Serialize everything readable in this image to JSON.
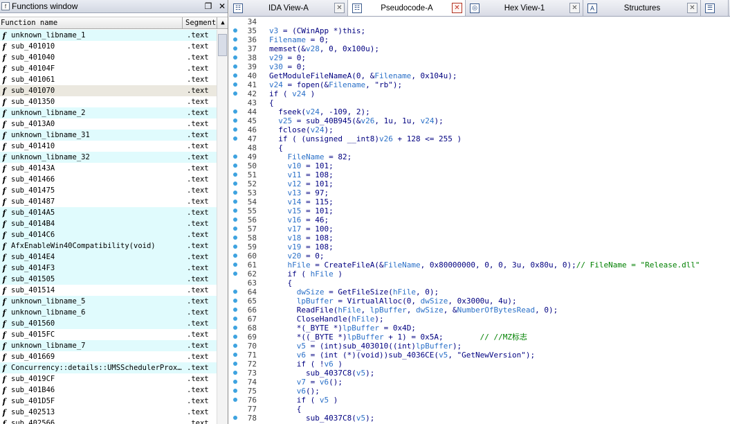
{
  "functions_window": {
    "title": "Functions window",
    "col_name": "Function name",
    "col_segment": "Segment",
    "rows": [
      {
        "name": "unknown_libname_1",
        "segment": ".text",
        "style": "lib"
      },
      {
        "name": "sub_401010",
        "segment": ".text",
        "style": ""
      },
      {
        "name": "sub_401040",
        "segment": ".text",
        "style": ""
      },
      {
        "name": "sub_40104F",
        "segment": ".text",
        "style": ""
      },
      {
        "name": "sub_401061",
        "segment": ".text",
        "style": ""
      },
      {
        "name": "sub_401070",
        "segment": ".text",
        "style": "sel"
      },
      {
        "name": "sub_401350",
        "segment": ".text",
        "style": ""
      },
      {
        "name": "unknown_libname_2",
        "segment": ".text",
        "style": "lib"
      },
      {
        "name": "sub_4013A0",
        "segment": ".text",
        "style": ""
      },
      {
        "name": "unknown_libname_31",
        "segment": ".text",
        "style": "lib"
      },
      {
        "name": "sub_401410",
        "segment": ".text",
        "style": ""
      },
      {
        "name": "unknown_libname_32",
        "segment": ".text",
        "style": "lib"
      },
      {
        "name": "sub_40143A",
        "segment": ".text",
        "style": ""
      },
      {
        "name": "sub_401466",
        "segment": ".text",
        "style": ""
      },
      {
        "name": "sub_401475",
        "segment": ".text",
        "style": ""
      },
      {
        "name": "sub_401487",
        "segment": ".text",
        "style": ""
      },
      {
        "name": "sub_4014A5",
        "segment": ".text",
        "style": "lib"
      },
      {
        "name": "sub_4014B4",
        "segment": ".text",
        "style": "lib"
      },
      {
        "name": "sub_4014C6",
        "segment": ".text",
        "style": "lib"
      },
      {
        "name": "AfxEnableWin40Compatibility(void)",
        "segment": ".text",
        "style": "lib"
      },
      {
        "name": "sub_4014E4",
        "segment": ".text",
        "style": "lib"
      },
      {
        "name": "sub_4014F3",
        "segment": ".text",
        "style": "lib"
      },
      {
        "name": "sub_401505",
        "segment": ".text",
        "style": "lib"
      },
      {
        "name": "sub_401514",
        "segment": ".text",
        "style": ""
      },
      {
        "name": "unknown_libname_5",
        "segment": ".text",
        "style": "lib"
      },
      {
        "name": "unknown_libname_6",
        "segment": ".text",
        "style": "lib"
      },
      {
        "name": "sub_401560",
        "segment": ".text",
        "style": "lib"
      },
      {
        "name": "sub_4015FC",
        "segment": ".text",
        "style": ""
      },
      {
        "name": "unknown_libname_7",
        "segment": ".text",
        "style": "lib"
      },
      {
        "name": "sub_401669",
        "segment": ".text",
        "style": ""
      },
      {
        "name": "Concurrency::details::UMSSchedulerProx…",
        "segment": ".text",
        "style": "lib"
      },
      {
        "name": "sub_4019CF",
        "segment": ".text",
        "style": ""
      },
      {
        "name": "sub_401B46",
        "segment": ".text",
        "style": ""
      },
      {
        "name": "sub_401D5F",
        "segment": ".text",
        "style": ""
      },
      {
        "name": "sub_402513",
        "segment": ".text",
        "style": ""
      },
      {
        "name": "sub_402566",
        "segment": ".text",
        "style": ""
      }
    ]
  },
  "tabs": [
    {
      "label": "IDA View-A",
      "icon": "ida-view-icon",
      "glyph": "☷",
      "active": false
    },
    {
      "label": "Pseudocode-A",
      "icon": "pseudocode-icon",
      "glyph": "☷",
      "active": true
    },
    {
      "label": "Hex View-1",
      "icon": "hex-view-icon",
      "glyph": "◎",
      "active": false
    },
    {
      "label": "Structures",
      "icon": "structures-icon",
      "glyph": "A",
      "active": false
    },
    {
      "label": "",
      "icon": "extra-tab-icon",
      "glyph": "☰",
      "active": false
    }
  ],
  "code_lines": [
    {
      "n": "34",
      "dot": false,
      "t": ""
    },
    {
      "n": "35",
      "dot": true,
      "t": "v3 = (CWinApp *)this;"
    },
    {
      "n": "36",
      "dot": true,
      "t": "Filename = 0;"
    },
    {
      "n": "37",
      "dot": true,
      "t": "memset(&v28, 0, 0x100u);"
    },
    {
      "n": "38",
      "dot": true,
      "t": "v29 = 0;"
    },
    {
      "n": "39",
      "dot": true,
      "t": "v30 = 0;"
    },
    {
      "n": "40",
      "dot": true,
      "t": "GetModuleFileNameA(0, &Filename, 0x104u);"
    },
    {
      "n": "41",
      "dot": true,
      "t": "v24 = fopen(&Filename, \"rb\");"
    },
    {
      "n": "42",
      "dot": true,
      "t": "if ( v24 )"
    },
    {
      "n": "43",
      "dot": false,
      "t": "{"
    },
    {
      "n": "44",
      "dot": true,
      "t": "  fseek(v24, -109, 2);"
    },
    {
      "n": "45",
      "dot": true,
      "t": "  v25 = sub_40B945(&v26, 1u, 1u, v24);"
    },
    {
      "n": "46",
      "dot": true,
      "t": "  fclose(v24);"
    },
    {
      "n": "47",
      "dot": true,
      "t": "  if ( (unsigned __int8)v26 + 128 <= 255 )"
    },
    {
      "n": "48",
      "dot": false,
      "t": "  {"
    },
    {
      "n": "49",
      "dot": true,
      "t": "    FileName = 82;"
    },
    {
      "n": "50",
      "dot": true,
      "t": "    v10 = 101;"
    },
    {
      "n": "51",
      "dot": true,
      "t": "    v11 = 108;"
    },
    {
      "n": "52",
      "dot": true,
      "t": "    v12 = 101;"
    },
    {
      "n": "53",
      "dot": true,
      "t": "    v13 = 97;"
    },
    {
      "n": "54",
      "dot": true,
      "t": "    v14 = 115;"
    },
    {
      "n": "55",
      "dot": true,
      "t": "    v15 = 101;"
    },
    {
      "n": "56",
      "dot": true,
      "t": "    v16 = 46;"
    },
    {
      "n": "57",
      "dot": true,
      "t": "    v17 = 100;"
    },
    {
      "n": "58",
      "dot": true,
      "t": "    v18 = 108;"
    },
    {
      "n": "59",
      "dot": true,
      "t": "    v19 = 108;"
    },
    {
      "n": "60",
      "dot": true,
      "t": "    v20 = 0;"
    },
    {
      "n": "61",
      "dot": true,
      "t": "    hFile = CreateFileA(&FileName, 0x80000000, 0, 0, 3u, 0x80u, 0);// FileName = \"Release.dll\""
    },
    {
      "n": "62",
      "dot": true,
      "t": "    if ( hFile )"
    },
    {
      "n": "63",
      "dot": false,
      "t": "    {"
    },
    {
      "n": "64",
      "dot": true,
      "t": "      dwSize = GetFileSize(hFile, 0);"
    },
    {
      "n": "65",
      "dot": true,
      "t": "      lpBuffer = VirtualAlloc(0, dwSize, 0x3000u, 4u);"
    },
    {
      "n": "66",
      "dot": true,
      "t": "      ReadFile(hFile, lpBuffer, dwSize, &NumberOfBytesRead, 0);"
    },
    {
      "n": "67",
      "dot": true,
      "t": "      CloseHandle(hFile);"
    },
    {
      "n": "68",
      "dot": true,
      "t": "      *(_BYTE *)lpBuffer = 0x4D;"
    },
    {
      "n": "69",
      "dot": true,
      "t": "      *((_BYTE *)lpBuffer + 1) = 0x5A;        // //MZ标志"
    },
    {
      "n": "70",
      "dot": true,
      "t": "      v5 = (int)sub_403010((int)lpBuffer);"
    },
    {
      "n": "71",
      "dot": true,
      "t": "      v6 = (int (*)(void))sub_4036CE(v5, \"GetNewVersion\");"
    },
    {
      "n": "72",
      "dot": true,
      "t": "      if ( !v6 )"
    },
    {
      "n": "73",
      "dot": true,
      "t": "        sub_4037C8(v5);"
    },
    {
      "n": "74",
      "dot": true,
      "t": "      v7 = v6();"
    },
    {
      "n": "75",
      "dot": true,
      "t": "      v6();"
    },
    {
      "n": "76",
      "dot": true,
      "t": "      if ( v5 )"
    },
    {
      "n": "77",
      "dot": false,
      "t": "      {"
    },
    {
      "n": "78",
      "dot": true,
      "t": "        sub_4037C8(v5);"
    }
  ]
}
